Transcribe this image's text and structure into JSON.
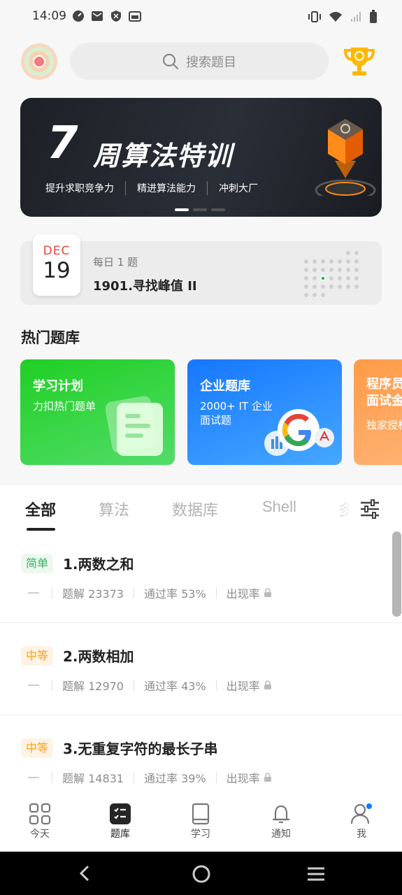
{
  "status_bar": {
    "time": "14:09"
  },
  "search": {
    "placeholder": "搜索题目"
  },
  "banner": {
    "number": "7",
    "title": "周算法特训",
    "subtitles": [
      "提升求职竞争力",
      "精进算法能力",
      "冲刺大厂"
    ]
  },
  "daily": {
    "month": "DEC",
    "day": "19",
    "label": "每日 1 题",
    "question": "1901.寻找峰值 II"
  },
  "hot": {
    "title": "热门题库",
    "cards": [
      {
        "title": "学习计划",
        "subtitle": "力扣热门题单",
        "color": "#1fcf23"
      },
      {
        "title": "企业题库",
        "subtitle": "2000+ IT 企业\n面试题",
        "color": "#1677ff"
      },
      {
        "title": "程序员\n面试金",
        "subtitle": "独家授权",
        "color": "#ff9b48"
      }
    ]
  },
  "tabs": [
    "全部",
    "算法",
    "数据库",
    "Shell",
    "多"
  ],
  "problems": [
    {
      "difficulty": "简单",
      "title": "1.两数之和",
      "solutions": "题解 23373",
      "pass": "通过率 53%",
      "freq": "出现率"
    },
    {
      "difficulty": "中等",
      "title": "2.两数相加",
      "solutions": "题解 12970",
      "pass": "通过率 43%",
      "freq": "出现率"
    },
    {
      "difficulty": "中等",
      "title": "3.无重复字符的最长子串",
      "solutions": "题解 14831",
      "pass": "通过率 39%",
      "freq": "出现率"
    }
  ],
  "nav": [
    "今天",
    "题库",
    "学习",
    "通知",
    "我"
  ]
}
